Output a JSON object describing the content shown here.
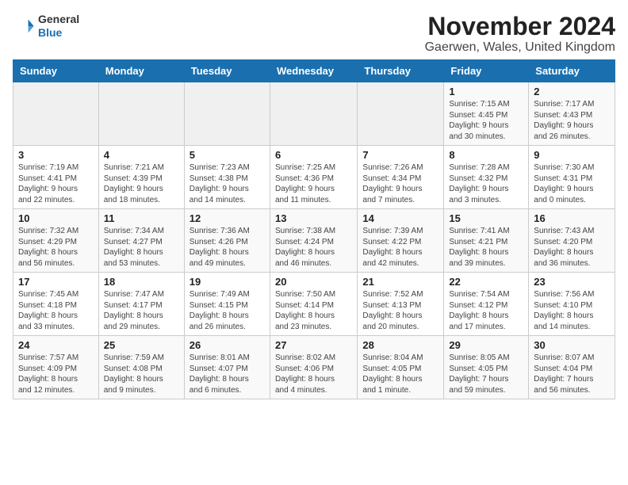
{
  "header": {
    "logo_line1": "General",
    "logo_line2": "Blue",
    "month": "November 2024",
    "location": "Gaerwen, Wales, United Kingdom"
  },
  "weekdays": [
    "Sunday",
    "Monday",
    "Tuesday",
    "Wednesday",
    "Thursday",
    "Friday",
    "Saturday"
  ],
  "weeks": [
    [
      {
        "day": "",
        "info": ""
      },
      {
        "day": "",
        "info": ""
      },
      {
        "day": "",
        "info": ""
      },
      {
        "day": "",
        "info": ""
      },
      {
        "day": "",
        "info": ""
      },
      {
        "day": "1",
        "info": "Sunrise: 7:15 AM\nSunset: 4:45 PM\nDaylight: 9 hours\nand 30 minutes."
      },
      {
        "day": "2",
        "info": "Sunrise: 7:17 AM\nSunset: 4:43 PM\nDaylight: 9 hours\nand 26 minutes."
      }
    ],
    [
      {
        "day": "3",
        "info": "Sunrise: 7:19 AM\nSunset: 4:41 PM\nDaylight: 9 hours\nand 22 minutes."
      },
      {
        "day": "4",
        "info": "Sunrise: 7:21 AM\nSunset: 4:39 PM\nDaylight: 9 hours\nand 18 minutes."
      },
      {
        "day": "5",
        "info": "Sunrise: 7:23 AM\nSunset: 4:38 PM\nDaylight: 9 hours\nand 14 minutes."
      },
      {
        "day": "6",
        "info": "Sunrise: 7:25 AM\nSunset: 4:36 PM\nDaylight: 9 hours\nand 11 minutes."
      },
      {
        "day": "7",
        "info": "Sunrise: 7:26 AM\nSunset: 4:34 PM\nDaylight: 9 hours\nand 7 minutes."
      },
      {
        "day": "8",
        "info": "Sunrise: 7:28 AM\nSunset: 4:32 PM\nDaylight: 9 hours\nand 3 minutes."
      },
      {
        "day": "9",
        "info": "Sunrise: 7:30 AM\nSunset: 4:31 PM\nDaylight: 9 hours\nand 0 minutes."
      }
    ],
    [
      {
        "day": "10",
        "info": "Sunrise: 7:32 AM\nSunset: 4:29 PM\nDaylight: 8 hours\nand 56 minutes."
      },
      {
        "day": "11",
        "info": "Sunrise: 7:34 AM\nSunset: 4:27 PM\nDaylight: 8 hours\nand 53 minutes."
      },
      {
        "day": "12",
        "info": "Sunrise: 7:36 AM\nSunset: 4:26 PM\nDaylight: 8 hours\nand 49 minutes."
      },
      {
        "day": "13",
        "info": "Sunrise: 7:38 AM\nSunset: 4:24 PM\nDaylight: 8 hours\nand 46 minutes."
      },
      {
        "day": "14",
        "info": "Sunrise: 7:39 AM\nSunset: 4:22 PM\nDaylight: 8 hours\nand 42 minutes."
      },
      {
        "day": "15",
        "info": "Sunrise: 7:41 AM\nSunset: 4:21 PM\nDaylight: 8 hours\nand 39 minutes."
      },
      {
        "day": "16",
        "info": "Sunrise: 7:43 AM\nSunset: 4:20 PM\nDaylight: 8 hours\nand 36 minutes."
      }
    ],
    [
      {
        "day": "17",
        "info": "Sunrise: 7:45 AM\nSunset: 4:18 PM\nDaylight: 8 hours\nand 33 minutes."
      },
      {
        "day": "18",
        "info": "Sunrise: 7:47 AM\nSunset: 4:17 PM\nDaylight: 8 hours\nand 29 minutes."
      },
      {
        "day": "19",
        "info": "Sunrise: 7:49 AM\nSunset: 4:15 PM\nDaylight: 8 hours\nand 26 minutes."
      },
      {
        "day": "20",
        "info": "Sunrise: 7:50 AM\nSunset: 4:14 PM\nDaylight: 8 hours\nand 23 minutes."
      },
      {
        "day": "21",
        "info": "Sunrise: 7:52 AM\nSunset: 4:13 PM\nDaylight: 8 hours\nand 20 minutes."
      },
      {
        "day": "22",
        "info": "Sunrise: 7:54 AM\nSunset: 4:12 PM\nDaylight: 8 hours\nand 17 minutes."
      },
      {
        "day": "23",
        "info": "Sunrise: 7:56 AM\nSunset: 4:10 PM\nDaylight: 8 hours\nand 14 minutes."
      }
    ],
    [
      {
        "day": "24",
        "info": "Sunrise: 7:57 AM\nSunset: 4:09 PM\nDaylight: 8 hours\nand 12 minutes."
      },
      {
        "day": "25",
        "info": "Sunrise: 7:59 AM\nSunset: 4:08 PM\nDaylight: 8 hours\nand 9 minutes."
      },
      {
        "day": "26",
        "info": "Sunrise: 8:01 AM\nSunset: 4:07 PM\nDaylight: 8 hours\nand 6 minutes."
      },
      {
        "day": "27",
        "info": "Sunrise: 8:02 AM\nSunset: 4:06 PM\nDaylight: 8 hours\nand 4 minutes."
      },
      {
        "day": "28",
        "info": "Sunrise: 8:04 AM\nSunset: 4:05 PM\nDaylight: 8 hours\nand 1 minute."
      },
      {
        "day": "29",
        "info": "Sunrise: 8:05 AM\nSunset: 4:05 PM\nDaylight: 7 hours\nand 59 minutes."
      },
      {
        "day": "30",
        "info": "Sunrise: 8:07 AM\nSunset: 4:04 PM\nDaylight: 7 hours\nand 56 minutes."
      }
    ]
  ]
}
